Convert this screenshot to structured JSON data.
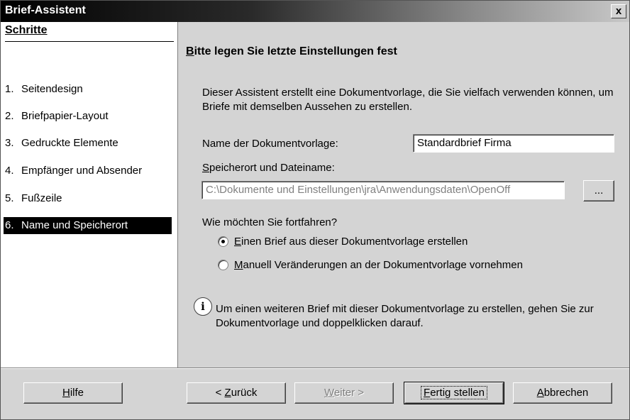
{
  "window": {
    "title": "Brief-Assistent",
    "close_glyph": "x"
  },
  "steps": {
    "heading": "Schritte",
    "items": [
      {
        "num": "1.",
        "label": "Seitendesign"
      },
      {
        "num": "2.",
        "label": "Briefpapier-Layout"
      },
      {
        "num": "3.",
        "label": "Gedruckte Elemente"
      },
      {
        "num": "4.",
        "label": "Empfänger und Absender"
      },
      {
        "num": "5.",
        "label": "Fußzeile"
      },
      {
        "num": "6.",
        "label": "Name und Speicherort"
      }
    ],
    "active_index": 5
  },
  "main": {
    "heading_first": "B",
    "heading_rest": "itte legen Sie letzte Einstellungen fest",
    "description": "Dieser Assistent erstellt eine Dokumentvorlage, die Sie vielfach verwenden können, um Briefe mit demselben Aussehen zu erstellen.",
    "template_name_label": "Name der Dokumentvorlage:",
    "template_name_value": "Standardbrief Firma",
    "location_label_first": "S",
    "location_label_rest": "peicherort und Dateiname:",
    "location_value": "C:\\Dokumente und Einstellungen\\jra\\Anwendungsdaten\\OpenOff",
    "browse_label": "...",
    "continue_question": "Wie möchten Sie fortfahren?",
    "radio_create_first": "E",
    "radio_create_rest": "inen Brief aus dieser Dokumentvorlage erstellen",
    "radio_modify_first": "M",
    "radio_modify_rest": "anuell Veränderungen an der Dokumentvorlage vornehmen",
    "selected_option": "create",
    "info_glyph": "i",
    "info_text": "Um einen weiteren Brief mit dieser Dokumentvorlage zu erstellen, gehen Sie zur Dokumentvorlage und doppelklicken darauf."
  },
  "buttons": {
    "help_first": "H",
    "help_rest": "ilfe",
    "back_prefix": "< ",
    "back_first": "Z",
    "back_rest": "urück",
    "next_first": "W",
    "next_rest": "eiter >",
    "finish_first": "F",
    "finish_rest": "ertig stellen",
    "cancel_first": "A",
    "cancel_rest": "bbrechen"
  }
}
